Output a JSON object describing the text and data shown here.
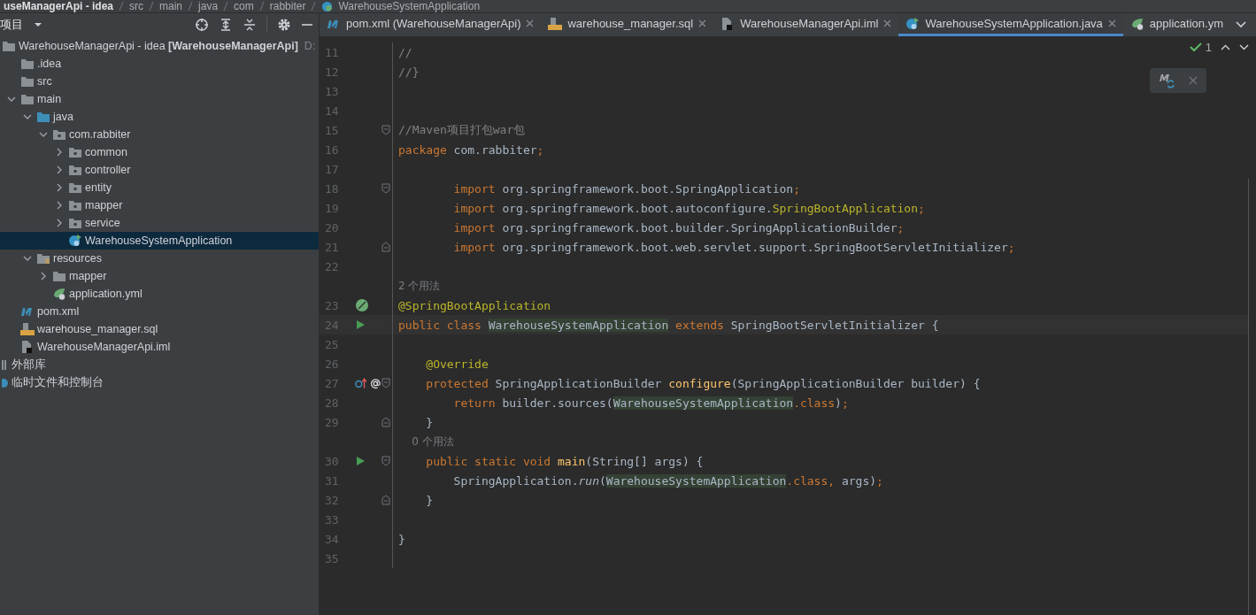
{
  "breadcrumb": [
    {
      "label": "useManagerApi - idea",
      "kind": "project"
    },
    {
      "label": "src",
      "kind": "folder"
    },
    {
      "label": "main",
      "kind": "folder"
    },
    {
      "label": "java",
      "kind": "folder"
    },
    {
      "label": "com",
      "kind": "folder"
    },
    {
      "label": "rabbiter",
      "kind": "folder"
    },
    {
      "label": "WarehouseSystemApplication",
      "kind": "spring"
    }
  ],
  "project_panel": {
    "title": "项目",
    "tree": [
      {
        "label": "WarehouseManagerApi - idea **[WarehouseManagerApi]**",
        "path": "D:",
        "kind": "module",
        "expanded": true,
        "selected": false,
        "children": [
          {
            "label": ".idea",
            "kind": "folder",
            "selected": false
          },
          {
            "label": "src",
            "kind": "folder",
            "selected": false
          },
          {
            "label": "main",
            "kind": "folder",
            "expanded": true,
            "selected": false,
            "children": [
              {
                "label": "java",
                "kind": "source",
                "expanded": true,
                "selected": false,
                "children": [
                  {
                    "label": "com.rabbiter",
                    "kind": "package",
                    "expanded": true,
                    "selected": false,
                    "children": [
                      {
                        "label": "common",
                        "kind": "package",
                        "expanded": false,
                        "selected": false
                      },
                      {
                        "label": "controller",
                        "kind": "package",
                        "expanded": false,
                        "selected": false
                      },
                      {
                        "label": "entity",
                        "kind": "package",
                        "expanded": false,
                        "selected": false
                      },
                      {
                        "label": "mapper",
                        "kind": "package",
                        "expanded": false,
                        "selected": false
                      },
                      {
                        "label": "service",
                        "kind": "package",
                        "expanded": false,
                        "selected": false
                      },
                      {
                        "label": "WarehouseSystemApplication",
                        "kind": "spring",
                        "selected": true
                      }
                    ]
                  }
                ]
              },
              {
                "label": "resources",
                "kind": "resources",
                "expanded": true,
                "selected": false,
                "children": [
                  {
                    "label": "mapper",
                    "kind": "folder",
                    "expanded": false,
                    "selected": false
                  },
                  {
                    "label": "application.yml",
                    "kind": "yml",
                    "selected": false
                  }
                ]
              }
            ]
          },
          {
            "label": "pom.xml",
            "kind": "maven",
            "selected": false
          },
          {
            "label": "warehouse_manager.sql",
            "kind": "sql",
            "selected": false
          },
          {
            "label": "WarehouseManagerApi.iml",
            "kind": "iml",
            "selected": false
          }
        ]
      },
      {
        "label": "外部库",
        "kind": "library",
        "selected": false
      },
      {
        "label": "临时文件和控制台",
        "kind": "scratch",
        "selected": false
      }
    ]
  },
  "tabs": [
    {
      "label": "pom.xml (WarehouseManagerApi)",
      "kind": "maven",
      "selected": false,
      "closable": true
    },
    {
      "label": "warehouse_manager.sql",
      "kind": "sql",
      "selected": false,
      "closable": true
    },
    {
      "label": "WarehouseManagerApi.iml",
      "kind": "iml",
      "selected": false,
      "closable": true
    },
    {
      "label": "WarehouseSystemApplication.java",
      "kind": "spring",
      "selected": true,
      "closable": true
    },
    {
      "label": "application.ym",
      "kind": "yml",
      "selected": false,
      "closable": false
    }
  ],
  "inspections": {
    "count": "1"
  },
  "lines": [
    {
      "kind": "code",
      "num": "11",
      "tokens": [
        {
          "t": "//",
          "kind": "comment"
        }
      ]
    },
    {
      "kind": "code",
      "num": "12",
      "tokens": [
        {
          "t": "//}",
          "kind": "comment"
        }
      ]
    },
    {
      "kind": "code",
      "num": "13"
    },
    {
      "kind": "code",
      "num": "14"
    },
    {
      "kind": "code",
      "num": "15",
      "fold": {
        "kind": "open"
      },
      "tokens": [
        {
          "t": "//Maven项目打包war包",
          "kind": "comment"
        }
      ]
    },
    {
      "kind": "code",
      "num": "16",
      "tokens": [
        {
          "t": "package",
          "kind": "kw"
        },
        {
          "t": " com.rabbiter",
          "kind": "plain"
        },
        {
          "t": ";",
          "kind": "kw"
        }
      ]
    },
    {
      "kind": "code",
      "num": "17"
    },
    {
      "kind": "code",
      "num": "18",
      "fold": {
        "kind": "open"
      },
      "tokens": [
        {
          "t": "        import",
          "kind": "kw"
        },
        {
          "t": " org.springframework.boot.SpringApplication",
          "kind": "plain"
        },
        {
          "t": ";",
          "kind": "kw"
        }
      ]
    },
    {
      "kind": "code",
      "num": "19",
      "tokens": [
        {
          "t": "        import",
          "kind": "kw"
        },
        {
          "t": " org.springframework.boot.autoconfigure.",
          "kind": "plain"
        },
        {
          "t": "SpringBootApplication",
          "kind": "ann"
        },
        {
          "t": ";",
          "kind": "kw"
        }
      ]
    },
    {
      "kind": "code",
      "num": "20",
      "tokens": [
        {
          "t": "        import",
          "kind": "kw"
        },
        {
          "t": " org.springframework.boot.builder.SpringApplicationBuilder",
          "kind": "plain"
        },
        {
          "t": ";",
          "kind": "kw"
        }
      ]
    },
    {
      "kind": "code",
      "num": "21",
      "fold": {
        "kind": "close"
      },
      "tokens": [
        {
          "t": "        import",
          "kind": "kw"
        },
        {
          "t": " org.springframework.boot.web.servlet.support.SpringBootServletInitializer",
          "kind": "plain"
        },
        {
          "t": ";",
          "kind": "kw"
        }
      ]
    },
    {
      "kind": "code",
      "num": "22"
    },
    {
      "kind": "hint",
      "text": "2 个用法"
    },
    {
      "kind": "code",
      "num": "23",
      "gutter": {
        "kind": "bean"
      },
      "tokens": [
        {
          "t": "@SpringBootApplication",
          "kind": "ann"
        }
      ]
    },
    {
      "kind": "code",
      "num": "24",
      "gutter": {
        "kind": "run"
      },
      "current": true,
      "tokens": [
        {
          "t": "public class ",
          "kind": "kw"
        },
        {
          "t": "WarehouseSystemApplication",
          "kind": "mark"
        },
        {
          "t": " extends ",
          "kind": "kw"
        },
        {
          "t": "SpringBootServletInitializer {",
          "kind": "plain"
        }
      ]
    },
    {
      "kind": "code",
      "num": "25"
    },
    {
      "kind": "code",
      "num": "26",
      "tokens": [
        {
          "t": "    @Override",
          "kind": "ann"
        }
      ]
    },
    {
      "kind": "code",
      "num": "27",
      "gutter": {
        "kind": "override"
      },
      "fold": {
        "kind": "open"
      },
      "tokens": [
        {
          "t": "    protected ",
          "kind": "kw"
        },
        {
          "t": "SpringApplicationBuilder ",
          "kind": "plain"
        },
        {
          "t": "configure",
          "kind": "fn"
        },
        {
          "t": "(SpringApplicationBuilder builder) {",
          "kind": "plain"
        }
      ]
    },
    {
      "kind": "code",
      "num": "28",
      "tokens": [
        {
          "t": "        return ",
          "kind": "kw"
        },
        {
          "t": "builder.sources(",
          "kind": "plain"
        },
        {
          "t": "WarehouseSystemApplication",
          "kind": "mark"
        },
        {
          "t": ".class",
          "kind": "kw"
        },
        {
          "t": ")",
          "kind": "plain"
        },
        {
          "t": ";",
          "kind": "kw"
        }
      ]
    },
    {
      "kind": "code",
      "num": "29",
      "fold": {
        "kind": "close"
      },
      "tokens": [
        {
          "t": "    }",
          "kind": "plain"
        }
      ]
    },
    {
      "kind": "hint",
      "text": "    0 个用法"
    },
    {
      "kind": "code",
      "num": "30",
      "gutter": {
        "kind": "run"
      },
      "fold": {
        "kind": "open"
      },
      "tokens": [
        {
          "t": "    public static void ",
          "kind": "kw"
        },
        {
          "t": "main",
          "kind": "fn"
        },
        {
          "t": "(String[] args) {",
          "kind": "plain"
        }
      ]
    },
    {
      "kind": "code",
      "num": "31",
      "tokens": [
        {
          "t": "        SpringApplication.",
          "kind": "plain"
        },
        {
          "t": "run",
          "kind": "italic"
        },
        {
          "t": "(",
          "kind": "plain"
        },
        {
          "t": "WarehouseSystemApplication",
          "kind": "mark"
        },
        {
          "t": ".class, ",
          "kind": "kw"
        },
        {
          "t": "args)",
          "kind": "plain"
        },
        {
          "t": ";",
          "kind": "kw"
        }
      ]
    },
    {
      "kind": "code",
      "num": "32",
      "fold": {
        "kind": "close"
      },
      "tokens": [
        {
          "t": "    }",
          "kind": "plain"
        }
      ]
    },
    {
      "kind": "code",
      "num": "33"
    },
    {
      "kind": "code",
      "num": "34",
      "tokens": [
        {
          "t": "}",
          "kind": "plain"
        }
      ]
    },
    {
      "kind": "code",
      "num": "35"
    }
  ]
}
